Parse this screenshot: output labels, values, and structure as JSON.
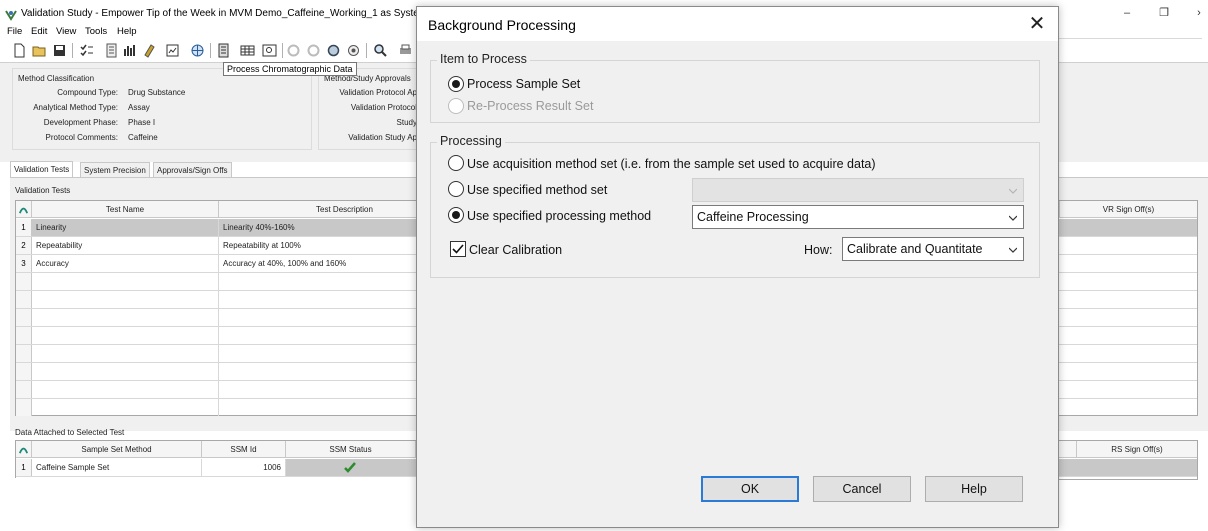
{
  "main_window": {
    "title": "Validation Study - Empower Tip of the Week in MVM Demo_Caffeine_Working_1 as System/Adi",
    "controls": {
      "minimize": "–",
      "maximize": "❐",
      "close": "›"
    },
    "menu": [
      "File",
      "Edit",
      "View",
      "Tools",
      "Help"
    ],
    "toolbar_tooltip": "Process Chromatographic Data",
    "method_classification": {
      "heading": "Method Classification",
      "fields": [
        {
          "label": "Compound Type:",
          "value": "Drug Substance"
        },
        {
          "label": "Analytical Method Type:",
          "value": "Assay"
        },
        {
          "label": "Development Phase:",
          "value": "Phase I"
        },
        {
          "label": "Protocol Comments:",
          "value": "Caffeine"
        }
      ]
    },
    "approvals_panel": {
      "heading": "Method/Study Approvals",
      "labels": [
        "Validation Protocol Ap",
        "Validation Protocol",
        "Study",
        "Validation Study Ap"
      ]
    },
    "tabs": [
      "Validation Tests",
      "System Precision",
      "Approvals/Sign Offs"
    ],
    "validation_tests": {
      "caption": "Validation Tests",
      "columns": [
        "Test Name",
        "Test Description",
        "VR Sign Off(s)"
      ],
      "rows": [
        {
          "num": "1",
          "name": "Linearity",
          "description": "Linearity 40%-160%"
        },
        {
          "num": "2",
          "name": "Repeatability",
          "description": "Repeatability at 100%"
        },
        {
          "num": "3",
          "name": "Accuracy",
          "description": "Accuracy at 40%, 100% and 160%"
        }
      ]
    },
    "attached_data": {
      "caption": "Data Attached to Selected Test",
      "columns": [
        "Sample Set Method",
        "SSM Id",
        "SSM Status",
        "RS Sign Off(s)"
      ],
      "rows": [
        {
          "num": "1",
          "method": "Caffeine Sample Set",
          "ssm_id": "1006",
          "status_icon": "green-check"
        }
      ]
    }
  },
  "dialog": {
    "title": "Background Processing",
    "close": "✕",
    "item_group": {
      "title": "Item to Process",
      "options": [
        {
          "label": "Process Sample Set",
          "checked": true,
          "enabled": true
        },
        {
          "label": "Re-Process Result Set",
          "checked": false,
          "enabled": false
        }
      ]
    },
    "processing_group": {
      "title": "Processing",
      "option_acquisition": "Use acquisition method set  (i.e. from the sample set used to acquire data)",
      "option_method_set": "Use specified method set",
      "option_processing": "Use specified processing method",
      "method_set_value": "",
      "processing_method_value": "Caffeine Processing",
      "clear_calibration_label": "Clear Calibration",
      "clear_calibration_checked": true,
      "how_label": "How:",
      "how_value": "Calibrate and Quantitate"
    },
    "buttons": {
      "ok": "OK",
      "cancel": "Cancel",
      "help": "Help"
    }
  },
  "colors": {
    "accent": "#2a7ad6",
    "dialog_bg": "#f0f0f0",
    "selected_row": "#c8c8c8",
    "check_green": "#2e8b2e"
  }
}
